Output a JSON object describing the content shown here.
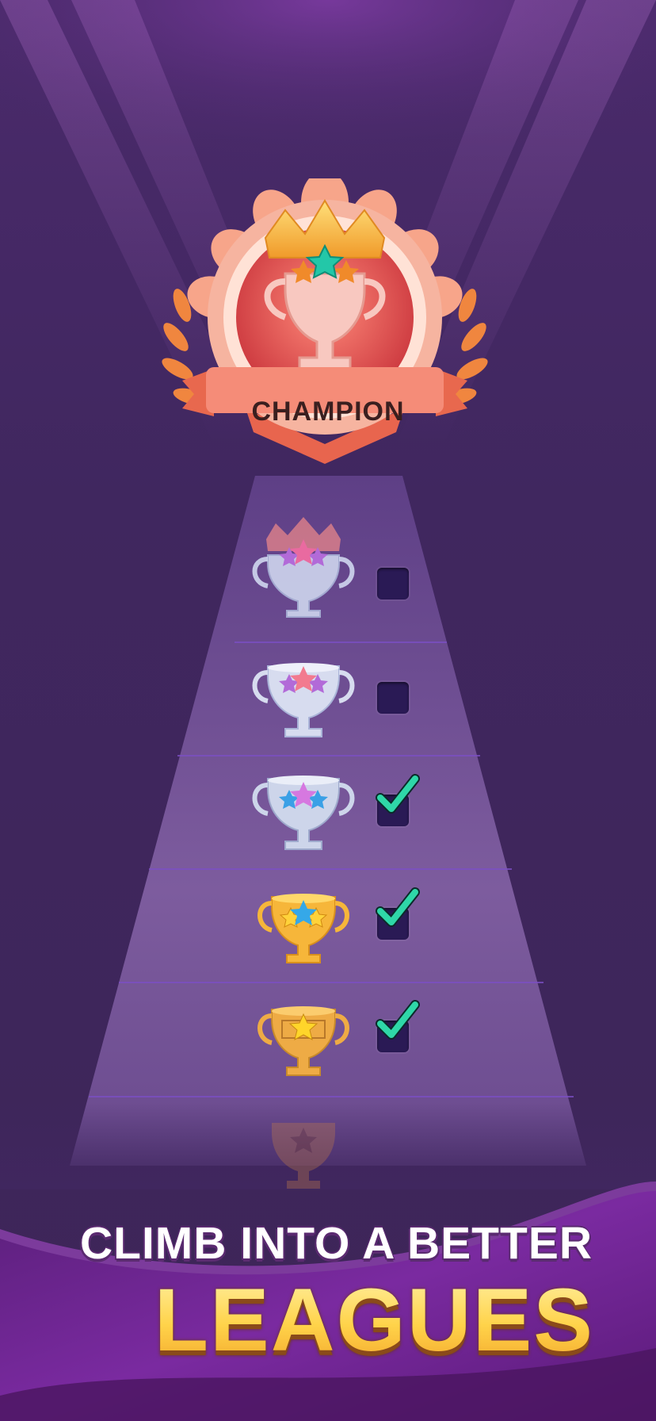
{
  "badge": {
    "label": "CHAMPION"
  },
  "headline": {
    "line1": "CLIMB INTO A BETTER",
    "line2": "LEAGUES"
  },
  "leagues": [
    {
      "tier": "platinum-crown",
      "completed": false
    },
    {
      "tier": "platinum",
      "completed": false
    },
    {
      "tier": "silver",
      "completed": true
    },
    {
      "tier": "gold",
      "completed": true
    },
    {
      "tier": "bronze-gold",
      "completed": true
    },
    {
      "tier": "faded",
      "completed": false
    }
  ],
  "colors": {
    "background": "#40275f",
    "path": "#7b5a9a",
    "badge": "#f08c6c",
    "headline_gold": "#ffd34a",
    "check": "#2fd7a8"
  }
}
